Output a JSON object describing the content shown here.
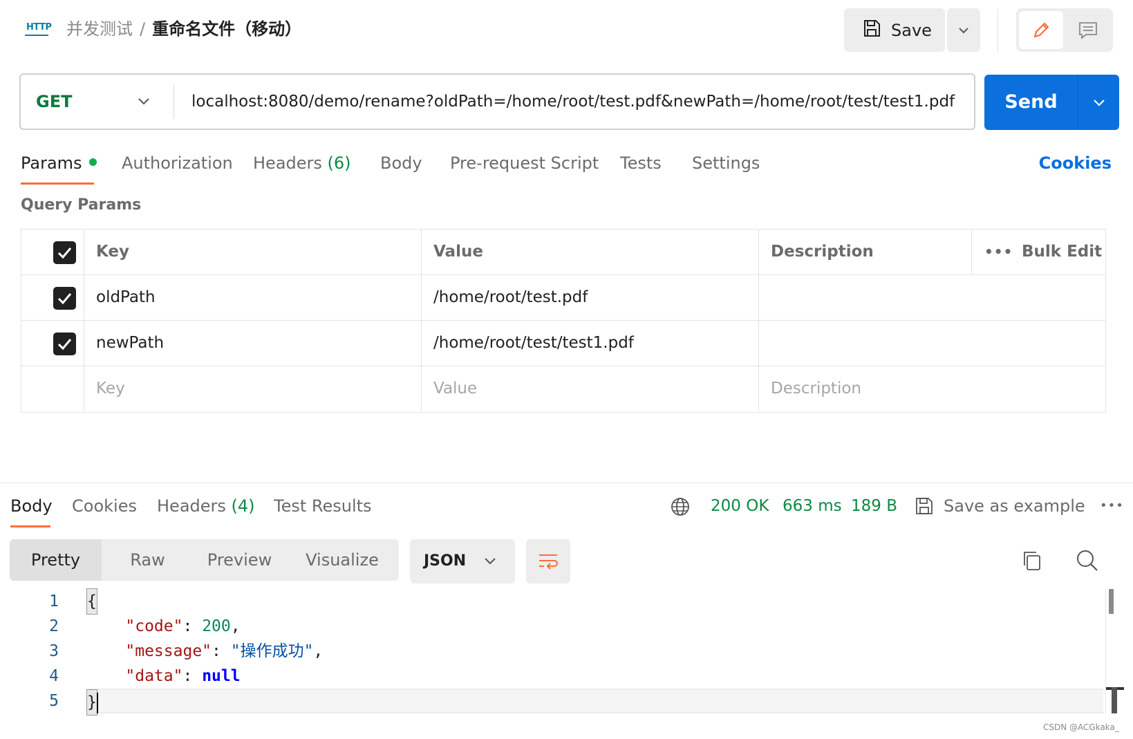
{
  "header": {
    "http_label": "HTTP",
    "breadcrumb_parent": "并发测试",
    "breadcrumb_separator": "/",
    "breadcrumb_current": "重命名文件（移动）",
    "save_label": "Save"
  },
  "request": {
    "method": "GET",
    "url": "localhost:8080/demo/rename?oldPath=/home/root/test.pdf&newPath=/home/root/test/test1.pdf",
    "send_label": "Send"
  },
  "request_tabs": {
    "params": "Params",
    "authorization": "Authorization",
    "headers": "Headers",
    "headers_count": "(6)",
    "body": "Body",
    "prerequest": "Pre-request Script",
    "tests": "Tests",
    "settings": "Settings",
    "cookies": "Cookies"
  },
  "query_params": {
    "title": "Query Params",
    "columns": {
      "key": "Key",
      "value": "Value",
      "description": "Description",
      "bulk_edit": "Bulk Edit"
    },
    "rows": [
      {
        "key": "oldPath",
        "value": "/home/root/test.pdf",
        "description": ""
      },
      {
        "key": "newPath",
        "value": "/home/root/test/test1.pdf",
        "description": ""
      }
    ],
    "placeholders": {
      "key": "Key",
      "value": "Value",
      "description": "Description"
    }
  },
  "response_tabs": {
    "body": "Body",
    "cookies": "Cookies",
    "headers": "Headers",
    "headers_count": "(4)",
    "test_results": "Test Results",
    "status": "200 OK",
    "time": "663 ms",
    "size": "189 B",
    "save_example": "Save as example"
  },
  "view": {
    "modes": [
      "Pretty",
      "Raw",
      "Preview",
      "Visualize"
    ],
    "format": "JSON"
  },
  "code": {
    "line_numbers": [
      "1",
      "2",
      "3",
      "4",
      "5"
    ],
    "open_brace": "{",
    "close_brace": "}",
    "key_code": "\"code\"",
    "val_code": "200",
    "key_message": "\"message\"",
    "val_message": "\"操作成功\"",
    "key_data": "\"data\"",
    "val_data": "null"
  },
  "watermark": "CSDN @ACGkaka_",
  "colors": {
    "accent_orange": "#ff6c37",
    "send_blue": "#0b6fde",
    "method_green": "#0b7a3c",
    "status_green": "#0b8a44"
  },
  "icons": [
    "http-icon",
    "save-icon",
    "chevron-down-icon",
    "pencil-icon",
    "comment-icon",
    "checkbox-icon",
    "more-icon",
    "globe-icon",
    "wrap-icon",
    "copy-icon",
    "search-icon"
  ]
}
